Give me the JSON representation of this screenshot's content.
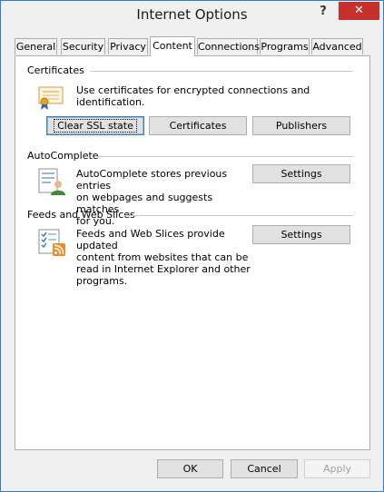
{
  "window": {
    "title": "Internet Options",
    "help_glyph": "?",
    "close_glyph": "✕"
  },
  "tabs": [
    {
      "label": "General"
    },
    {
      "label": "Security"
    },
    {
      "label": "Privacy"
    },
    {
      "label": "Content"
    },
    {
      "label": "Connections"
    },
    {
      "label": "Programs"
    },
    {
      "label": "Advanced"
    }
  ],
  "active_tab": "Content",
  "certificates": {
    "heading": "Certificates",
    "description": "Use certificates for encrypted connections and identification.",
    "icon": "certificate-icon",
    "clear_ssl_label": "Clear SSL state",
    "certificates_label": "Certificates",
    "publishers_label": "Publishers"
  },
  "autocomplete": {
    "heading": "AutoComplete",
    "description_lines": [
      "AutoComplete stores previous entries",
      "on webpages and suggests matches",
      "for you."
    ],
    "icon": "autocomplete-form-icon",
    "settings_label": "Settings"
  },
  "feeds": {
    "heading": "Feeds and Web Slices",
    "description_lines": [
      "Feeds and Web Slices provide updated",
      "content from websites that can be",
      "read in Internet Explorer and other",
      "programs."
    ],
    "icon": "feeds-rss-icon",
    "settings_label": "Settings"
  },
  "footer": {
    "ok_label": "OK",
    "cancel_label": "Cancel",
    "apply_label": "Apply"
  },
  "colors": {
    "accent": "#2b7fd4",
    "close": "#c7302b",
    "rss": "#f08a24"
  }
}
